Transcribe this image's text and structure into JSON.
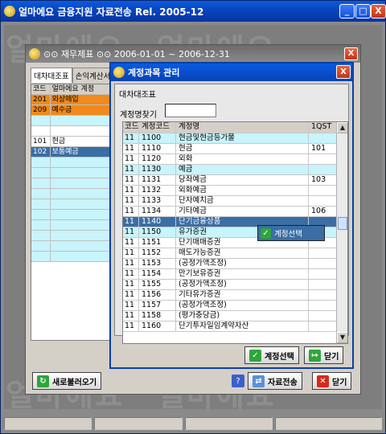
{
  "app": {
    "title": "얼마에요 금융지원 자료전송 Rel. 2005-12",
    "title_buttons": {
      "minimize": "_",
      "maximize": "□",
      "close": "X"
    }
  },
  "watermark": "얼마에요",
  "middle_window": {
    "title": "⊙⊙ 재무제표 ⊙⊙ 2006-01-01 ~ 2006-12-31",
    "close": "X",
    "tabs": [
      "대차대조표",
      "손익계산서"
    ],
    "left_grid": {
      "headers": [
        "코드",
        "얼마에요 계정"
      ],
      "rows": [
        {
          "code": "201",
          "name": "외상매입",
          "style": "orange"
        },
        {
          "code": "209",
          "name": "예수금",
          "style": "orange"
        },
        {
          "code": "",
          "name": "",
          "style": "cyan"
        },
        {
          "code": "",
          "name": "",
          "style": "white"
        },
        {
          "code": "101",
          "name": "현금",
          "style": "white"
        },
        {
          "code": "102",
          "name": "보통예금",
          "style": "blue"
        },
        {
          "code": "",
          "name": "",
          "style": "cyan"
        },
        {
          "code": "",
          "name": "",
          "style": "cyan"
        },
        {
          "code": "",
          "name": "",
          "style": "cyan"
        },
        {
          "code": "",
          "name": "",
          "style": "cyan"
        },
        {
          "code": "",
          "name": "",
          "style": "cyan"
        },
        {
          "code": "",
          "name": "",
          "style": "cyan"
        },
        {
          "code": "",
          "name": "",
          "style": "cyan"
        },
        {
          "code": "",
          "name": "",
          "style": "cyan"
        },
        {
          "code": "",
          "name": "",
          "style": "cyan"
        },
        {
          "code": "",
          "name": "",
          "style": "cyan"
        }
      ]
    },
    "refresh_button": "새로불러오기",
    "transfer_button": "자료전송",
    "close_button": "닫기",
    "help_icon": "?"
  },
  "dialog": {
    "title": "계정과목 관리",
    "close": "X",
    "section_label": "대차대조표",
    "search_label": "계정명찾기",
    "search_value": "",
    "headers": [
      "코드",
      "계정코드",
      "계정명",
      "1QST"
    ],
    "rows": [
      {
        "c": "11",
        "code": "1100",
        "name": "현금및현금등가물",
        "q": "",
        "style": "cyan"
      },
      {
        "c": "11",
        "code": "1110",
        "name": "현금",
        "q": "101",
        "style": "white"
      },
      {
        "c": "11",
        "code": "1120",
        "name": "외화",
        "q": "",
        "style": "white"
      },
      {
        "c": "11",
        "code": "1130",
        "name": "예금",
        "q": "",
        "style": "cyan"
      },
      {
        "c": "11",
        "code": "1131",
        "name": "당좌예금",
        "q": "103",
        "style": "white"
      },
      {
        "c": "11",
        "code": "1132",
        "name": "외화예금",
        "q": "",
        "style": "white"
      },
      {
        "c": "11",
        "code": "1133",
        "name": "단자예치금",
        "q": "",
        "style": "white"
      },
      {
        "c": "11",
        "code": "1134",
        "name": "기타예금",
        "q": "106",
        "style": "white"
      },
      {
        "c": "11",
        "code": "1140",
        "name": "단기금융상품",
        "q": "",
        "style": "sel"
      },
      {
        "c": "11",
        "code": "1150",
        "name": "유가증권",
        "q": "",
        "style": "cyan"
      },
      {
        "c": "11",
        "code": "1151",
        "name": "단기매매증권",
        "q": "",
        "style": "white"
      },
      {
        "c": "11",
        "code": "1152",
        "name": "매도가능증권",
        "q": "",
        "style": "white"
      },
      {
        "c": "11",
        "code": "1153",
        "name": "(공정가액조정)",
        "q": "",
        "style": "white"
      },
      {
        "c": "11",
        "code": "1154",
        "name": "만기보유증권",
        "q": "",
        "style": "white"
      },
      {
        "c": "11",
        "code": "1155",
        "name": "(공정가액조정)",
        "q": "",
        "style": "white"
      },
      {
        "c": "11",
        "code": "1156",
        "name": "기타유가증권",
        "q": "",
        "style": "white"
      },
      {
        "c": "11",
        "code": "1157",
        "name": "(공정가액조정)",
        "q": "",
        "style": "white"
      },
      {
        "c": "11",
        "code": "1158",
        "name": "(평가충당금)",
        "q": "",
        "style": "white"
      },
      {
        "c": "11",
        "code": "1160",
        "name": "단기투자일임계약자산",
        "q": "",
        "style": "white"
      }
    ],
    "popup_label": "계정선택",
    "select_button": "계정선택",
    "close_button": "닫기"
  },
  "colors": {
    "orange": "#f08a1c",
    "blue_row": "#3a6ea5",
    "cyan_row": "#c8f4fc",
    "accent_green": "#2fa53a",
    "accent_red": "#d8291c"
  }
}
